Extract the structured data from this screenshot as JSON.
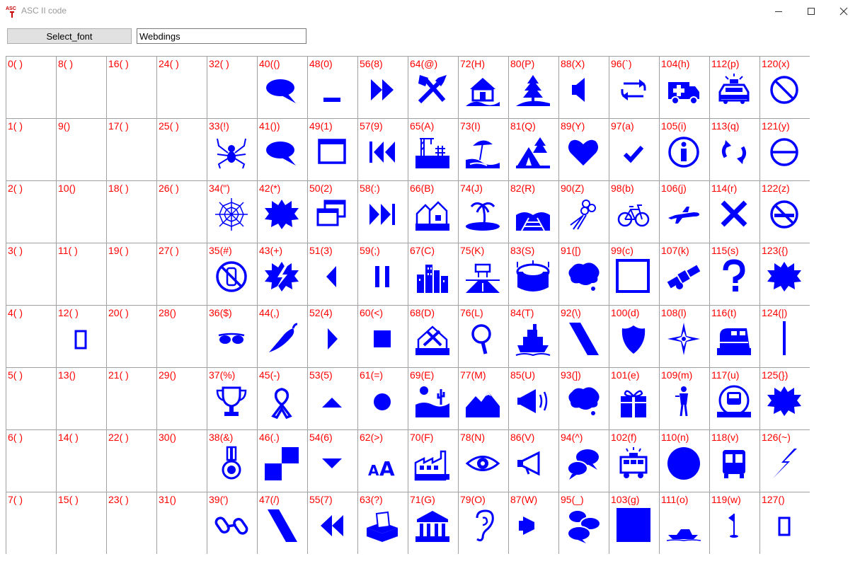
{
  "window": {
    "title": "ASC II code",
    "icon_text": "ASC"
  },
  "toolbar": {
    "select_font_label": "Select_font",
    "font_value": "Webdings"
  },
  "colors": {
    "label": "#ff0000",
    "glyph": "#0000ff",
    "grid_line": "#a0a0a0"
  },
  "cells": [
    {
      "label": "0( )",
      "icon": "none"
    },
    {
      "label": "1( )",
      "icon": "none"
    },
    {
      "label": "2( )",
      "icon": "none"
    },
    {
      "label": "3( )",
      "icon": "none"
    },
    {
      "label": "4( )",
      "icon": "none"
    },
    {
      "label": "5( )",
      "icon": "none"
    },
    {
      "label": "6( )",
      "icon": "none"
    },
    {
      "label": "7( )",
      "icon": "none"
    },
    {
      "label": "8( )",
      "icon": "none"
    },
    {
      "label": "9()",
      "icon": "none"
    },
    {
      "label": "10()",
      "icon": "none"
    },
    {
      "label": "11( )",
      "icon": "none"
    },
    {
      "label": "12( )",
      "icon": "rect-outline"
    },
    {
      "label": "13()",
      "icon": "none"
    },
    {
      "label": "14( )",
      "icon": "none"
    },
    {
      "label": "15( )",
      "icon": "none"
    },
    {
      "label": "16( )",
      "icon": "none"
    },
    {
      "label": "17( )",
      "icon": "none"
    },
    {
      "label": "18( )",
      "icon": "none"
    },
    {
      "label": "19( )",
      "icon": "none"
    },
    {
      "label": "20( )",
      "icon": "none"
    },
    {
      "label": "21( )",
      "icon": "none"
    },
    {
      "label": "22( )",
      "icon": "none"
    },
    {
      "label": "23( )",
      "icon": "none"
    },
    {
      "label": "24( )",
      "icon": "none"
    },
    {
      "label": "25( )",
      "icon": "none"
    },
    {
      "label": "26( )",
      "icon": "none"
    },
    {
      "label": "27( )",
      "icon": "none"
    },
    {
      "label": "28()",
      "icon": "none"
    },
    {
      "label": "29()",
      "icon": "none"
    },
    {
      "label": "30()",
      "icon": "none"
    },
    {
      "label": "31()",
      "icon": "none"
    },
    {
      "label": "32( )",
      "icon": "none"
    },
    {
      "label": "33(!)",
      "icon": "spider"
    },
    {
      "label": "34(\")",
      "icon": "web"
    },
    {
      "label": "35(#)",
      "icon": "no-phone"
    },
    {
      "label": "36($)",
      "icon": "sunglasses"
    },
    {
      "label": "37(%)",
      "icon": "trophy"
    },
    {
      "label": "38(&)",
      "icon": "medal"
    },
    {
      "label": "39(')",
      "icon": "chain-link"
    },
    {
      "label": "40(()",
      "icon": "speech-bubble"
    },
    {
      "label": "41())",
      "icon": "speech-bubble"
    },
    {
      "label": "42(*)",
      "icon": "starburst"
    },
    {
      "label": "43(+)",
      "icon": "starburst-bolt"
    },
    {
      "label": "44(,)",
      "icon": "chili-pepper"
    },
    {
      "label": "45(-)",
      "icon": "ribbon"
    },
    {
      "label": "46(.)",
      "icon": "checker"
    },
    {
      "label": "47(/)",
      "icon": "slash-bar"
    },
    {
      "label": "48(0)",
      "icon": "minimize-bar"
    },
    {
      "label": "49(1)",
      "icon": "window"
    },
    {
      "label": "50(2)",
      "icon": "restore-windows"
    },
    {
      "label": "51(3)",
      "icon": "triangle-left"
    },
    {
      "label": "52(4)",
      "icon": "triangle-right"
    },
    {
      "label": "53(5)",
      "icon": "triangle-up"
    },
    {
      "label": "54(6)",
      "icon": "triangle-down"
    },
    {
      "label": "55(7)",
      "icon": "rewind"
    },
    {
      "label": "56(8)",
      "icon": "fast-forward"
    },
    {
      "label": "57(9)",
      "icon": "skip-back"
    },
    {
      "label": "58(:)",
      "icon": "skip-forward"
    },
    {
      "label": "59(;)",
      "icon": "pause"
    },
    {
      "label": "60(<)",
      "icon": "stop-square"
    },
    {
      "label": "61(=)",
      "icon": "dot"
    },
    {
      "label": "62(>)",
      "icon": "font-size"
    },
    {
      "label": "63(?)",
      "icon": "ballot-box"
    },
    {
      "label": "64(@)",
      "icon": "tools"
    },
    {
      "label": "65(A)",
      "icon": "construction"
    },
    {
      "label": "66(B)",
      "icon": "houses"
    },
    {
      "label": "67(C)",
      "icon": "city"
    },
    {
      "label": "68(D)",
      "icon": "house-tools"
    },
    {
      "label": "69(E)",
      "icon": "desert"
    },
    {
      "label": "70(F)",
      "icon": "factory"
    },
    {
      "label": "71(G)",
      "icon": "government"
    },
    {
      "label": "72(H)",
      "icon": "house"
    },
    {
      "label": "73(I)",
      "icon": "beach"
    },
    {
      "label": "74(J)",
      "icon": "island"
    },
    {
      "label": "75(K)",
      "icon": "highway"
    },
    {
      "label": "76(L)",
      "icon": "magnifier"
    },
    {
      "label": "77(M)",
      "icon": "mountain"
    },
    {
      "label": "78(N)",
      "icon": "eye"
    },
    {
      "label": "79(O)",
      "icon": "ear"
    },
    {
      "label": "80(P)",
      "icon": "forest-road"
    },
    {
      "label": "81(Q)",
      "icon": "camping"
    },
    {
      "label": "82(R)",
      "icon": "railroad"
    },
    {
      "label": "83(S)",
      "icon": "stadium"
    },
    {
      "label": "84(T)",
      "icon": "cruise-ship"
    },
    {
      "label": "85(U)",
      "icon": "megaphone-loud"
    },
    {
      "label": "86(V)",
      "icon": "megaphone"
    },
    {
      "label": "87(W)",
      "icon": "speaker-half"
    },
    {
      "label": "88(X)",
      "icon": "speaker"
    },
    {
      "label": "89(Y)",
      "icon": "heart"
    },
    {
      "label": "90(Z)",
      "icon": "bouquet"
    },
    {
      "label": "91([)",
      "icon": "cloud-bubble"
    },
    {
      "label": "92(\\)",
      "icon": "slash-bar"
    },
    {
      "label": "93(])",
      "icon": "cloud-bubble"
    },
    {
      "label": "94(^)",
      "icon": "two-bubbles"
    },
    {
      "label": "95(_)",
      "icon": "three-bubbles"
    },
    {
      "label": "96(`)",
      "icon": "repeat"
    },
    {
      "label": "97(a)",
      "icon": "checkmark"
    },
    {
      "label": "98(b)",
      "icon": "bicycle"
    },
    {
      "label": "99(c)",
      "icon": "square-outline"
    },
    {
      "label": "100(d)",
      "icon": "shield"
    },
    {
      "label": "101(e)",
      "icon": "gift"
    },
    {
      "label": "102(f)",
      "icon": "fire-truck"
    },
    {
      "label": "103(g)",
      "icon": "square-filled"
    },
    {
      "label": "104(h)",
      "icon": "ambulance"
    },
    {
      "label": "105(i)",
      "icon": "info"
    },
    {
      "label": "106(j)",
      "icon": "airplane"
    },
    {
      "label": "107(k)",
      "icon": "satellite"
    },
    {
      "label": "108(l)",
      "icon": "compass-star"
    },
    {
      "label": "109(m)",
      "icon": "waiter"
    },
    {
      "label": "110(n)",
      "icon": "circle-filled"
    },
    {
      "label": "111(o)",
      "icon": "speedboat"
    },
    {
      "label": "112(p)",
      "icon": "police-car"
    },
    {
      "label": "113(q)",
      "icon": "refresh"
    },
    {
      "label": "114(r)",
      "icon": "x-mark"
    },
    {
      "label": "115(s)",
      "icon": "question-mark"
    },
    {
      "label": "116(t)",
      "icon": "train"
    },
    {
      "label": "117(u)",
      "icon": "metro"
    },
    {
      "label": "118(v)",
      "icon": "bus"
    },
    {
      "label": "119(w)",
      "icon": "golf-flag"
    },
    {
      "label": "120(x)",
      "icon": "no-sign"
    },
    {
      "label": "121(y)",
      "icon": "no-entry"
    },
    {
      "label": "122(z)",
      "icon": "no-smoking"
    },
    {
      "label": "123({)",
      "icon": "starburst"
    },
    {
      "label": "124(|)",
      "icon": "vertical-bar"
    },
    {
      "label": "125(})",
      "icon": "starburst"
    },
    {
      "label": "126(~)",
      "icon": "lightning"
    },
    {
      "label": "127()",
      "icon": "rect-outline"
    }
  ]
}
